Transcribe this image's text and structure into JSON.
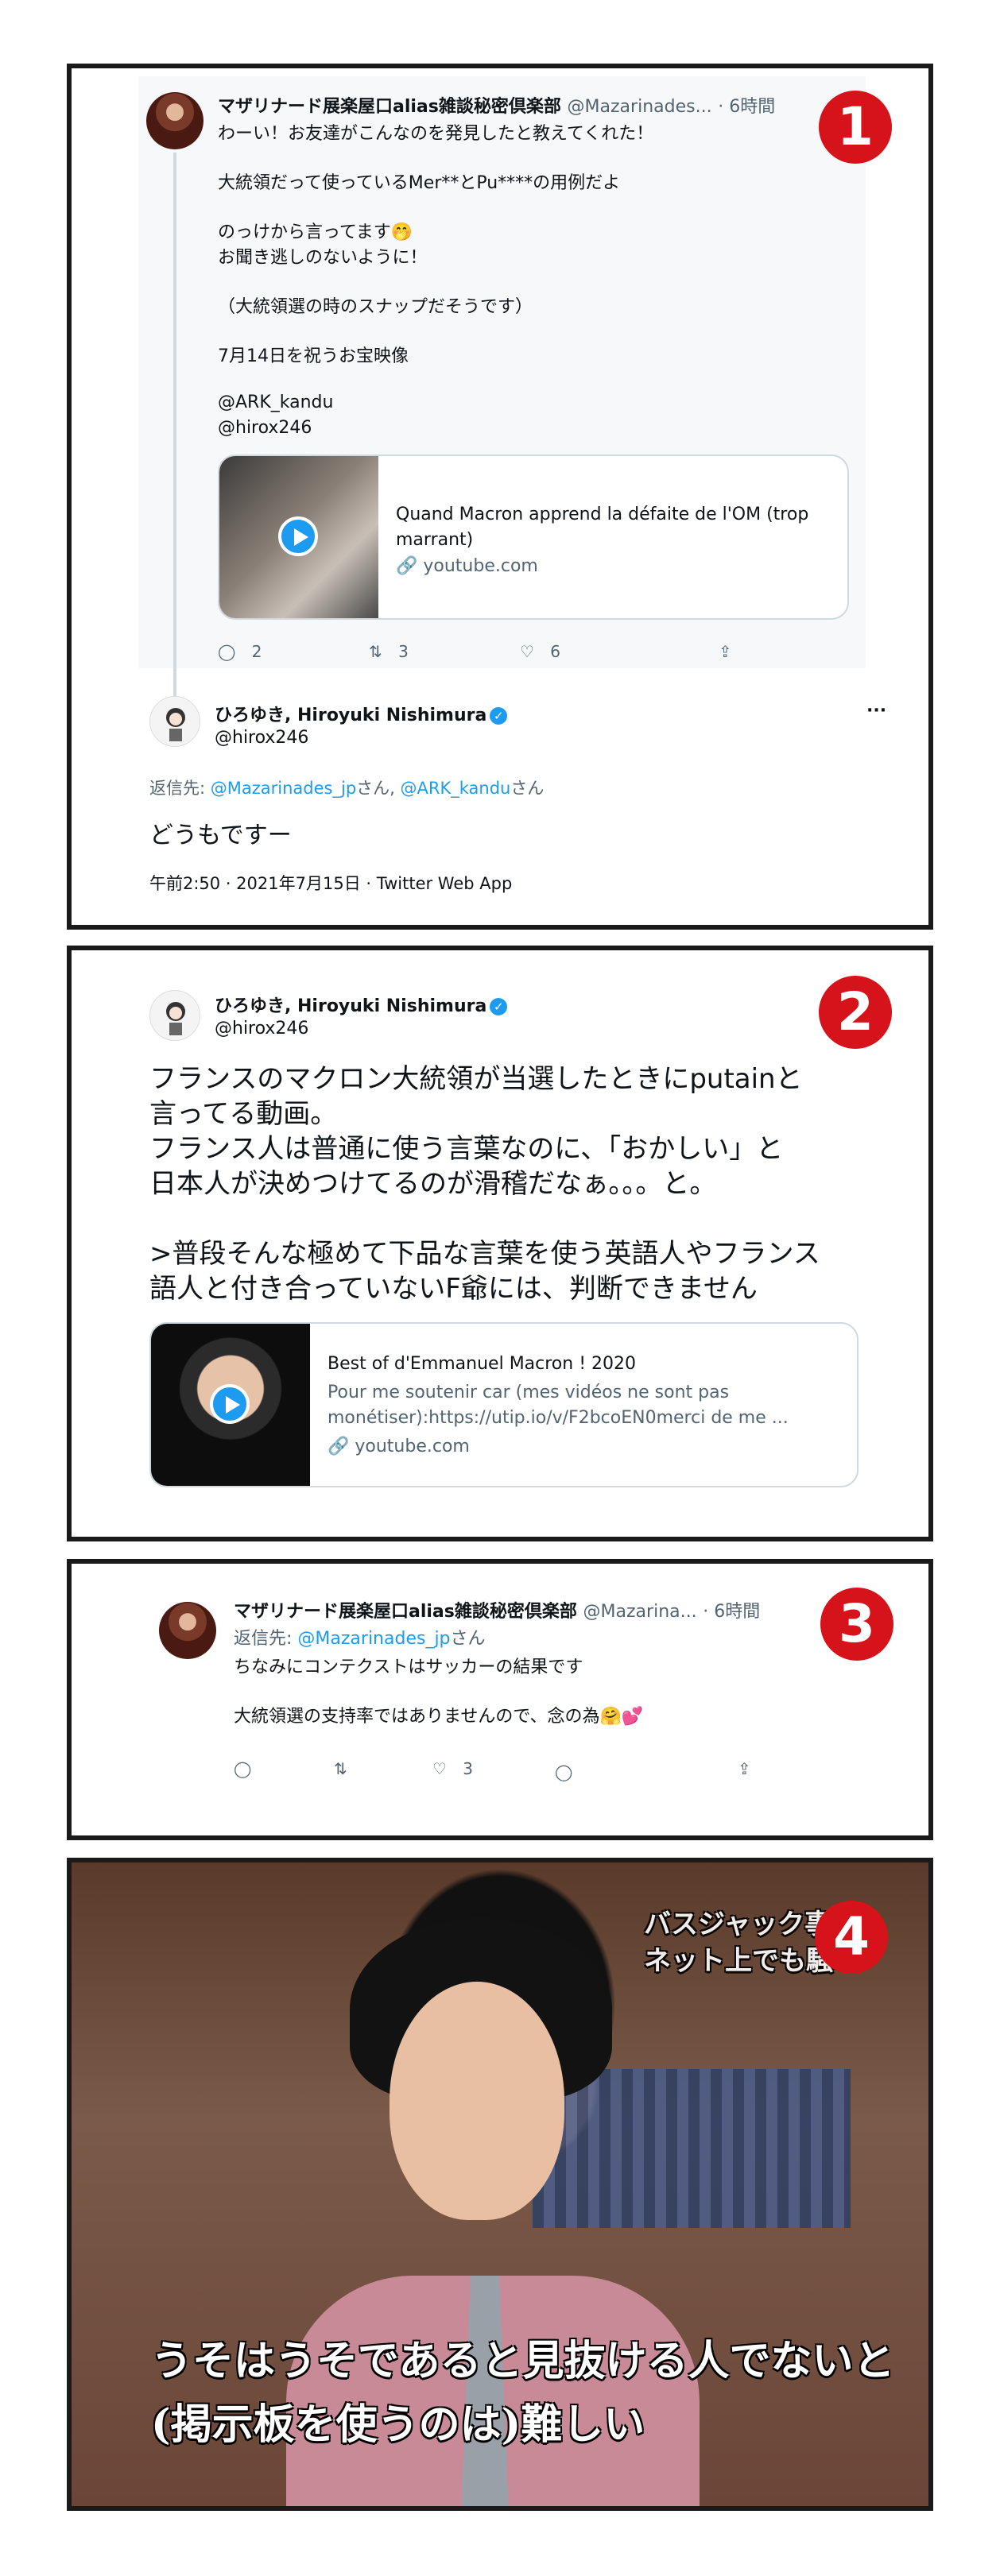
{
  "panel1": {
    "badge": "1",
    "quoted": {
      "name": "マザリナード展楽屋口alias雑談秘密倶楽部",
      "handle": "@Mazarinades...",
      "time": "· 6時間",
      "lines": [
        "わーい！お友達がこんなのを発見したと教えてくれた！",
        "大統領だって使っているMer**とPu****の用例だよ",
        "のっけから言ってます🤭",
        "お聞き逃しのないように！",
        "（大統領選の時のスナップだそうです）",
        "7月14日を祝うお宝映像",
        "@ARK_kandu",
        "@hirox246"
      ],
      "card_title": "Quand Macron apprend la défaite de l'OM (trop marrant)",
      "card_domain": "🔗 youtube.com",
      "replies": "2",
      "retweets": "3",
      "likes": "6"
    },
    "reply": {
      "name": "ひろゆき, Hiroyuki Nishimura",
      "handle": "@hirox246",
      "reply_to_prefix": "返信先: ",
      "reply_to_users": "@Mazarinades_jp",
      "reply_to_mid": "さん, ",
      "reply_to_users2": "@ARK_kandu",
      "reply_to_suffix": "さん",
      "text": "どうもですー",
      "meta": "午前2:50 · 2021年7月15日 · Twitter Web App",
      "more": "···"
    }
  },
  "panel2": {
    "badge": "2",
    "name": "ひろゆき, Hiroyuki Nishimura",
    "handle": "@hirox246",
    "lines": [
      "フランスのマクロン大統領が当選したときにputainと",
      "言ってる動画。",
      "フランス人は普通に使う言葉なのに、「おかしい」と",
      "日本人が決めつけてるのが滑稽だなぁ。。。と。",
      ">普段そんな極めて下品な言葉を使う英語人やフランス",
      "語人と付き合っていないF爺には、判断できません"
    ],
    "card_title": "Best of d'Emmanuel Macron ! 2020",
    "card_desc1": "Pour me soutenir car (mes vidéos ne sont pas",
    "card_desc2": "monétiser):https://utip.io/v/F2bcoEN0merci de me ...",
    "card_domain": "🔗 youtube.com"
  },
  "panel3": {
    "badge": "3",
    "name": "マザリナード展楽屋口alias雑談秘密倶楽部",
    "handle": "@Mazarina...",
    "time": "· 6時間",
    "reply_to_prefix": "返信先: ",
    "reply_to_user": "@Mazarinades_jp",
    "reply_to_suffix": "さん",
    "line1": "ちなみにコンテクストはサッカーの結果です",
    "line2": "大統領選の支持率ではありませんので、念の為🤗💕",
    "likes": "3"
  },
  "panel4": {
    "badge": "4",
    "caption_top1": "バスジャック事件",
    "caption_top2": "ネット上でも騒",
    "caption_line1": "うそはうそであると見抜ける人でないと",
    "caption_line2": "(掲示板を使うのは)難しい"
  },
  "icons": {
    "reply": "reply-icon",
    "retweet": "retweet-icon",
    "like": "heart-icon",
    "share": "share-icon",
    "verified": "verified-badge-icon",
    "link": "link-icon"
  },
  "colors": {
    "accent": "#1d9bf0",
    "badge": "#d6121a",
    "text_secondary": "#536471"
  }
}
